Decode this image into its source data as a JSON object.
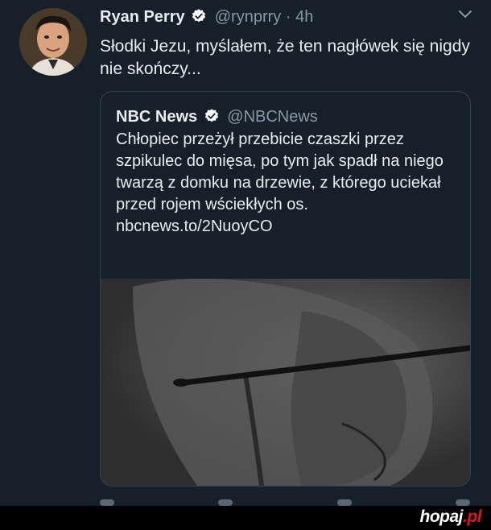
{
  "tweet": {
    "author_name": "Ryan Perry",
    "handle": "@rynprry",
    "separator": "·",
    "time": "4h",
    "text": "Słodki Jezu, myślałem, że ten nagłówek się nigdy nie skończy..."
  },
  "quoted_tweet": {
    "author_name": "NBC News",
    "handle": "@NBCNews",
    "text": "Chłopiec przeżył przebicie czaszki przez szpikulec do mięsa, po tym jak spadł na niego twarzą z domku na drzewie, z którego uciekał przed rojem wściekłych os.",
    "link": "nbcnews.to/2NuoyCO"
  },
  "watermark": {
    "brand": "hopaj",
    "domain": ".pl"
  },
  "colors": {
    "background": "#15202b",
    "verified_badge": "#ffffff",
    "secondary_text": "#8899a6",
    "card_border": "#38444d",
    "watermark_accent": "#e0141b"
  },
  "icons": [
    "avatar-photo",
    "verified-badge-icon",
    "chevron-down-icon",
    "reply-icon",
    "retweet-icon",
    "like-icon",
    "share-icon"
  ]
}
